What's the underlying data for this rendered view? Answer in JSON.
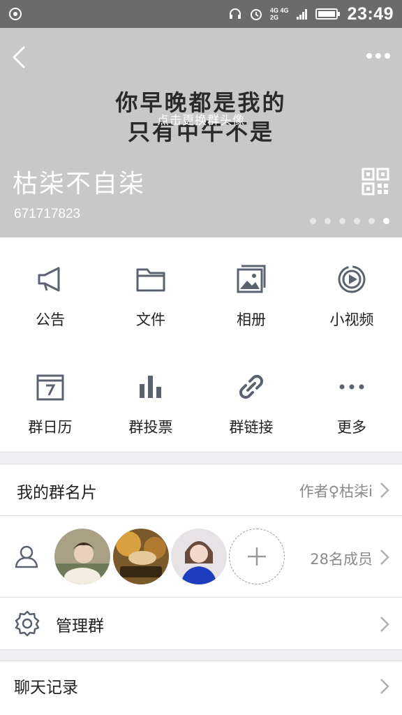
{
  "status_bar": {
    "network_top": "4G 4G",
    "network_bottom": "2G",
    "time": "23:49",
    "icons": [
      "app-notification-icon",
      "headset-icon",
      "alarm-icon",
      "signal-icon",
      "battery-icon"
    ]
  },
  "header": {
    "avatar_line1": "你早晚都是我的",
    "avatar_line2": "只有中午不是",
    "change_avatar_hint": "点击更换群头像",
    "group_name": "枯柒不自柒",
    "group_id": "671717823",
    "page_indicator": {
      "count": 6,
      "active_index": 5
    }
  },
  "features": [
    {
      "label": "公告",
      "icon": "megaphone-icon"
    },
    {
      "label": "文件",
      "icon": "folder-icon"
    },
    {
      "label": "相册",
      "icon": "photo-album-icon"
    },
    {
      "label": "小视频",
      "icon": "video-play-icon"
    },
    {
      "label": "群日历",
      "icon": "calendar-icon"
    },
    {
      "label": "群投票",
      "icon": "bar-chart-icon"
    },
    {
      "label": "群链接",
      "icon": "link-icon"
    },
    {
      "label": "更多",
      "icon": "more-dots-icon"
    }
  ],
  "group_card": {
    "label": "我的群名片",
    "value": "作者♀枯柒i"
  },
  "members": {
    "count_label": "28名成员"
  },
  "manage": {
    "label": "管理群"
  },
  "chat_history": {
    "label": "聊天记录"
  },
  "colors": {
    "header_bg": "#c8c8c8",
    "statusbar_bg": "#6b6b6b",
    "icon_gray": "#5a6270"
  }
}
